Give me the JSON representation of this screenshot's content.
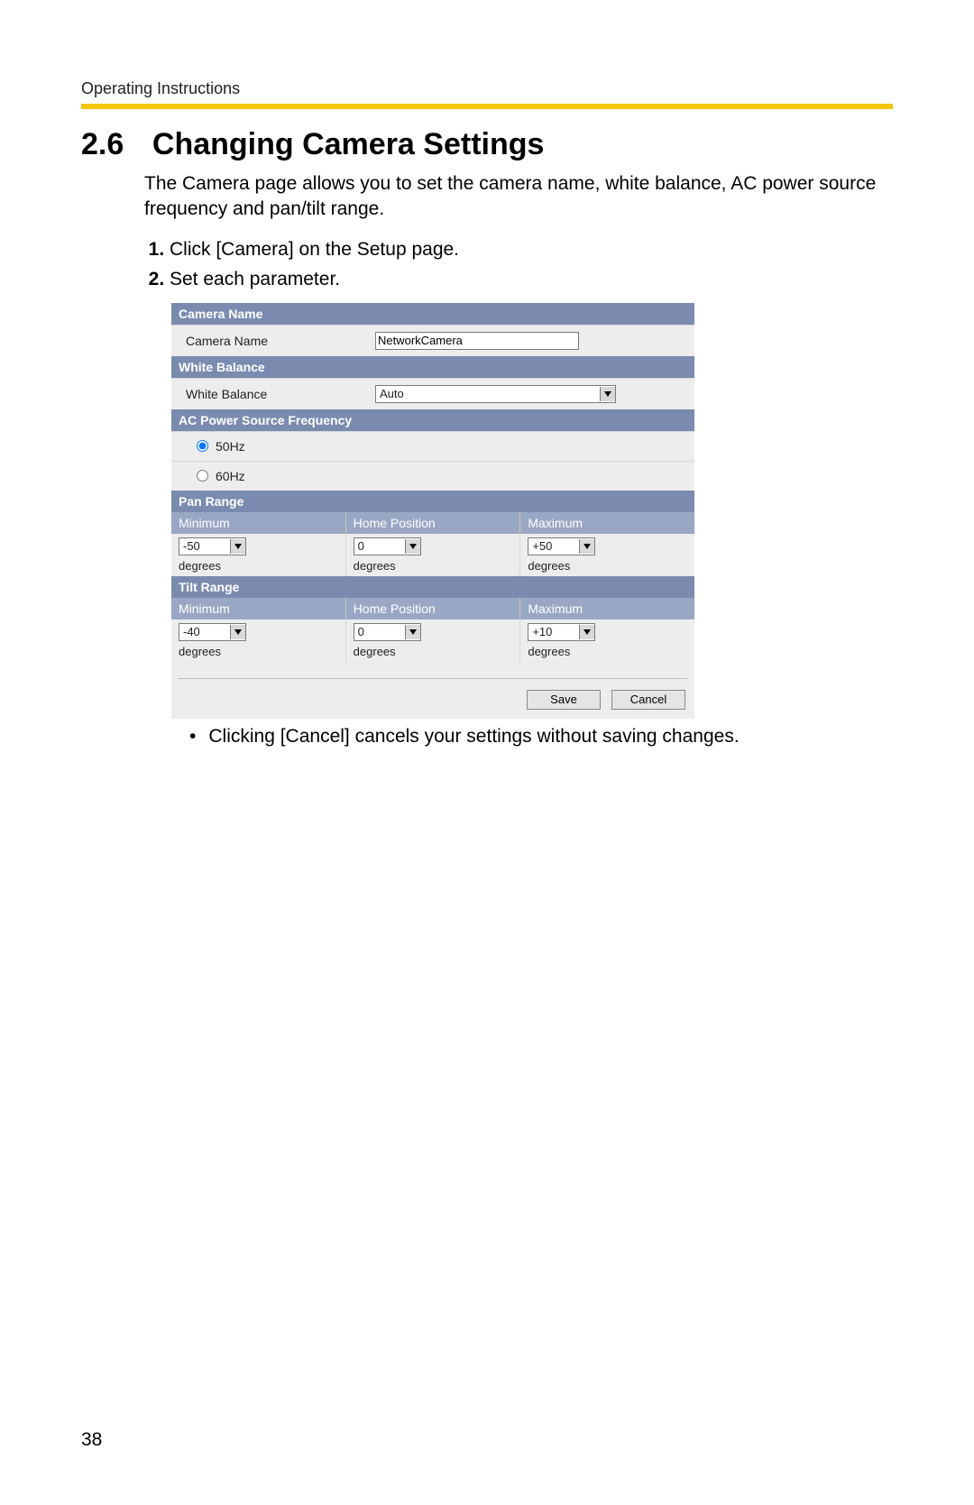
{
  "header": {
    "label": "Operating Instructions"
  },
  "section": {
    "number": "2.6",
    "title": "Changing Camera Settings"
  },
  "intro": "The Camera page allows you to set the camera name, white balance, AC power source frequency and pan/tilt range.",
  "steps": [
    "Click [Camera] on the Setup page.",
    "Set each parameter."
  ],
  "panel": {
    "camera_name": {
      "header": "Camera Name",
      "label": "Camera Name",
      "value": "NetworkCamera"
    },
    "white_balance": {
      "header": "White Balance",
      "label": "White Balance",
      "value": "Auto"
    },
    "ac_freq": {
      "header": "AC Power Source Frequency",
      "options": [
        "50Hz",
        "60Hz"
      ],
      "selected": "50Hz"
    },
    "pan": {
      "header": "Pan Range",
      "cols": [
        "Minimum",
        "Home Position",
        "Maximum"
      ],
      "values": {
        "min": "-50",
        "home": "0",
        "max": "+50"
      },
      "unit": "degrees"
    },
    "tilt": {
      "header": "Tilt Range",
      "cols": [
        "Minimum",
        "Home Position",
        "Maximum"
      ],
      "values": {
        "min": "-40",
        "home": "0",
        "max": "+10"
      },
      "unit": "degrees"
    },
    "buttons": {
      "save": "Save",
      "cancel": "Cancel"
    }
  },
  "note": "Clicking [Cancel] cancels your settings without saving changes.",
  "page_number": "38"
}
